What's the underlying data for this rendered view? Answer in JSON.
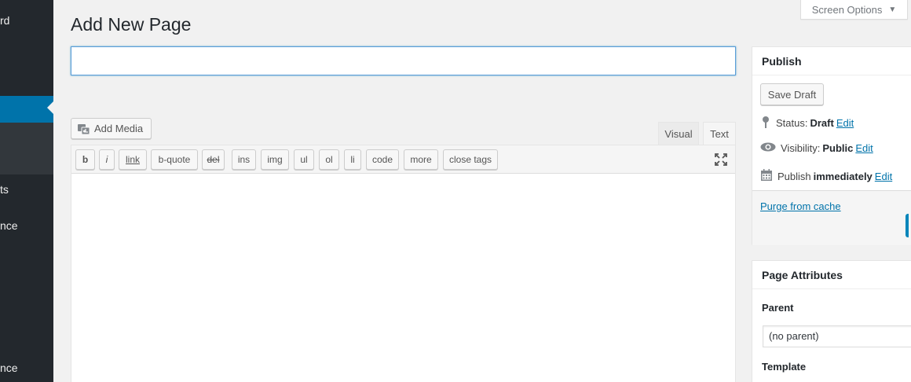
{
  "admin_menu": {
    "fragments": [
      "rd",
      "ts",
      "nce",
      "nce"
    ]
  },
  "screen_options": {
    "label": "Screen Options",
    "arrow": "▼"
  },
  "page_title": "Add New Page",
  "title_input": {
    "value": "",
    "placeholder": ""
  },
  "editor": {
    "add_media_label": "Add Media",
    "tabs": {
      "visual": "Visual",
      "text": "Text"
    },
    "quicktags": [
      "b",
      "i",
      "link",
      "b-quote",
      "del",
      "ins",
      "img",
      "ul",
      "ol",
      "li",
      "code",
      "more",
      "close tags"
    ]
  },
  "publish": {
    "title": "Publish",
    "save_draft": "Save Draft",
    "status_label": "Status:",
    "status_value": "Draft",
    "visibility_label": "Visibility:",
    "visibility_value": "Public",
    "publish_label": "Publish",
    "publish_value": "immediately",
    "edit_label": "Edit",
    "purge_link": "Purge from cache"
  },
  "page_attributes": {
    "title": "Page Attributes",
    "parent_label": "Parent",
    "parent_value": "(no parent)",
    "template_label": "Template"
  },
  "colors": {
    "sidebar": "#23282d",
    "accent": "#0073aa",
    "link": "#0073aa"
  }
}
